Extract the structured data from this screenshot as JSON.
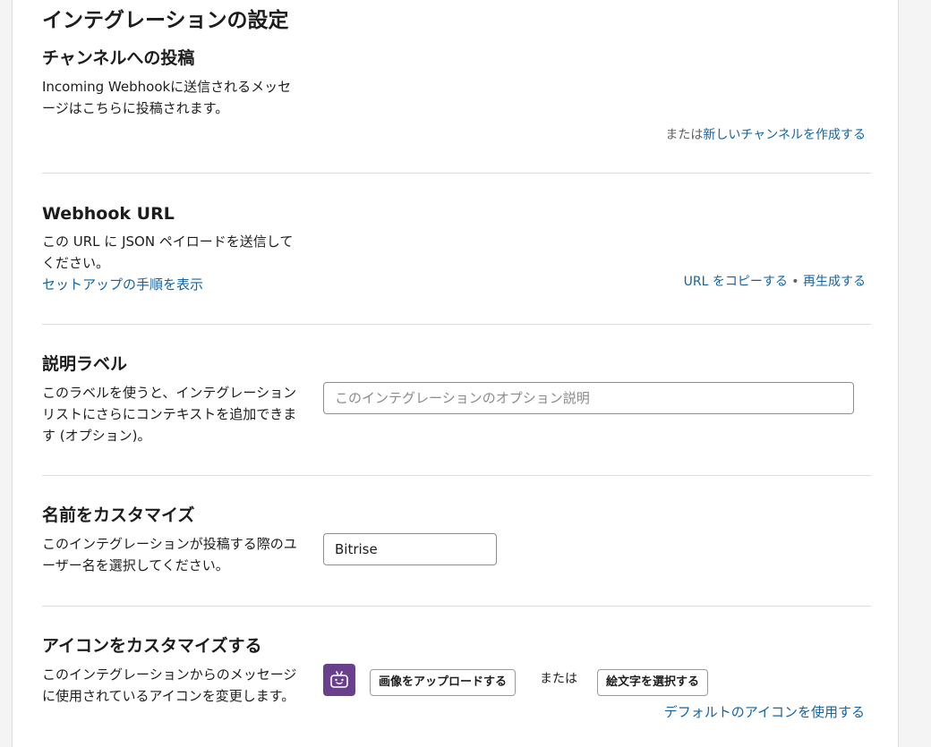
{
  "page": {
    "title": "インテグレーションの設定"
  },
  "channel_section": {
    "title": "チャンネルへの投稿",
    "description": "Incoming Webhookに送信されるメッセージはこちらに投稿されます。",
    "or_text": "または",
    "create_channel_link": "新しいチャンネルを作成する"
  },
  "webhook_section": {
    "title": "Webhook URL",
    "description": "この URL に JSON ペイロードを送信してください。",
    "setup_link": "セットアップの手順を表示",
    "copy_link": "URL をコピーする",
    "separator": "•",
    "regenerate_link": "再生成する"
  },
  "label_section": {
    "title": "説明ラベル",
    "description": "このラベルを使うと、インテグレーションリストにさらにコンテキストを追加できます (オプション)。",
    "input_placeholder": "このインテグレーションのオプション説明",
    "input_value": ""
  },
  "name_section": {
    "title": "名前をカスタマイズ",
    "description": "このインテグレーションが投稿する際のユーザー名を選択してください。",
    "input_value": "Bitrise"
  },
  "icon_section": {
    "title": "アイコンをカスタマイズする",
    "description": "このインテグレーションからのメッセージに使用されているアイコンを変更します。",
    "icon_name": "bot-face-icon",
    "icon_color": "#6a3f8e",
    "upload_button": "画像をアップロードする",
    "or_text": "または",
    "emoji_button": "絵文字を選択する",
    "default_icon_link": "デフォルトのアイコンを使用する"
  },
  "colors": {
    "link": "#1264a3",
    "divider": "#dddddd",
    "text": "#1d1c1d"
  }
}
